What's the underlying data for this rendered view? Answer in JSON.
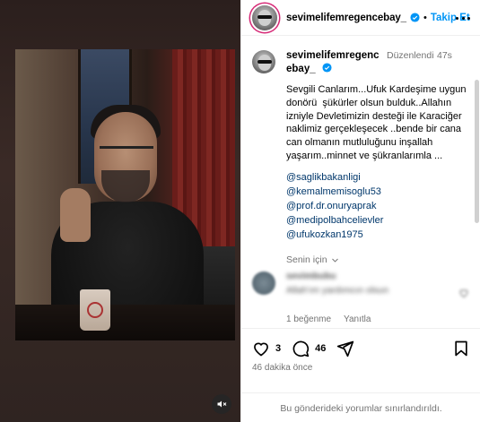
{
  "header": {
    "username": "sevimelifemregencebay_",
    "separator": "•",
    "follow_label": "Takip Et"
  },
  "caption": {
    "username": "sevimelifemregencebay_",
    "edited_label": "Düzenlendi",
    "time": "47s",
    "text": "Sevgili Canlarım...Ufuk Kardeşime uygun donörü  şükürler olsun bulduk..Allahın izniyle Devletimizin desteği ile Karaciğer naklimiz gerçekleşecek ..bende bir cana can olmanın mutluluğunu inşallah yaşarım..minnet ve şükranlarımla ...",
    "mentions": [
      "@saglikbakanligi",
      "@kemalmemisoglu53",
      "@prof.dr.onuryaprak",
      "@medipolbahcelievler",
      "@ufukozkan1975"
    ],
    "translation_label": "Senin için"
  },
  "comment": {
    "username": "sevimbubu",
    "text": "Allah'ım yardımcın olsun",
    "likes_label": "1 beğenme",
    "reply_label": "Yanıtla"
  },
  "actions": {
    "likes_count": "3",
    "comments_count": "46",
    "time_ago": "46 dakika önce",
    "comments_limited": "Bu gönderideki yorumlar sınırlandırıldı."
  },
  "icons": {
    "verified": "verified-badge-icon",
    "more": "more-options-icon",
    "like": "heart-icon",
    "comment": "comment-icon",
    "share": "share-icon",
    "save": "bookmark-icon",
    "mute": "mute-icon"
  },
  "colors": {
    "accent": "#0095f6",
    "mention": "#00376b",
    "secondary_text": "#737373"
  }
}
